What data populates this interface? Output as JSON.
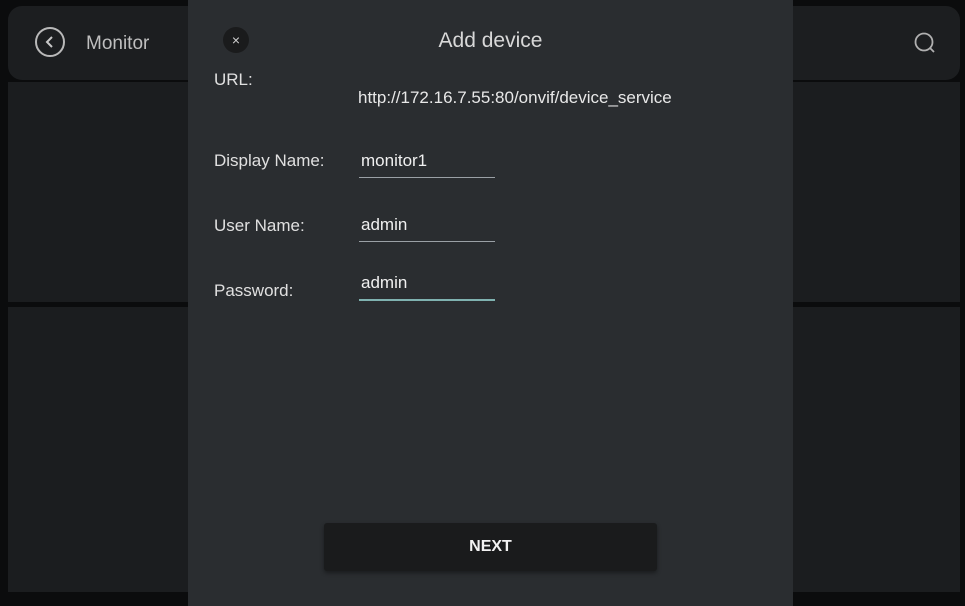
{
  "background": {
    "header_title": "Monitor",
    "back_icon": "chevron-left-icon",
    "refresh_icon": "refresh-icon"
  },
  "dialog": {
    "title": "Add device",
    "close_glyph": "×",
    "close_icon": "close-icon",
    "url_label": "URL:",
    "url_value": "http://172.16.7.55:80/onvif/device_service",
    "display_name_label": "Display Name:",
    "display_name_value": "monitor1",
    "user_name_label": "User Name:",
    "user_name_value": "admin",
    "password_label": "Password:",
    "password_value": "admin",
    "next_label": "NEXT"
  },
  "colors": {
    "dialog_bg": "#2a2d30",
    "page_bg": "#0b0c0d",
    "active_underline": "#7fb2b0"
  }
}
